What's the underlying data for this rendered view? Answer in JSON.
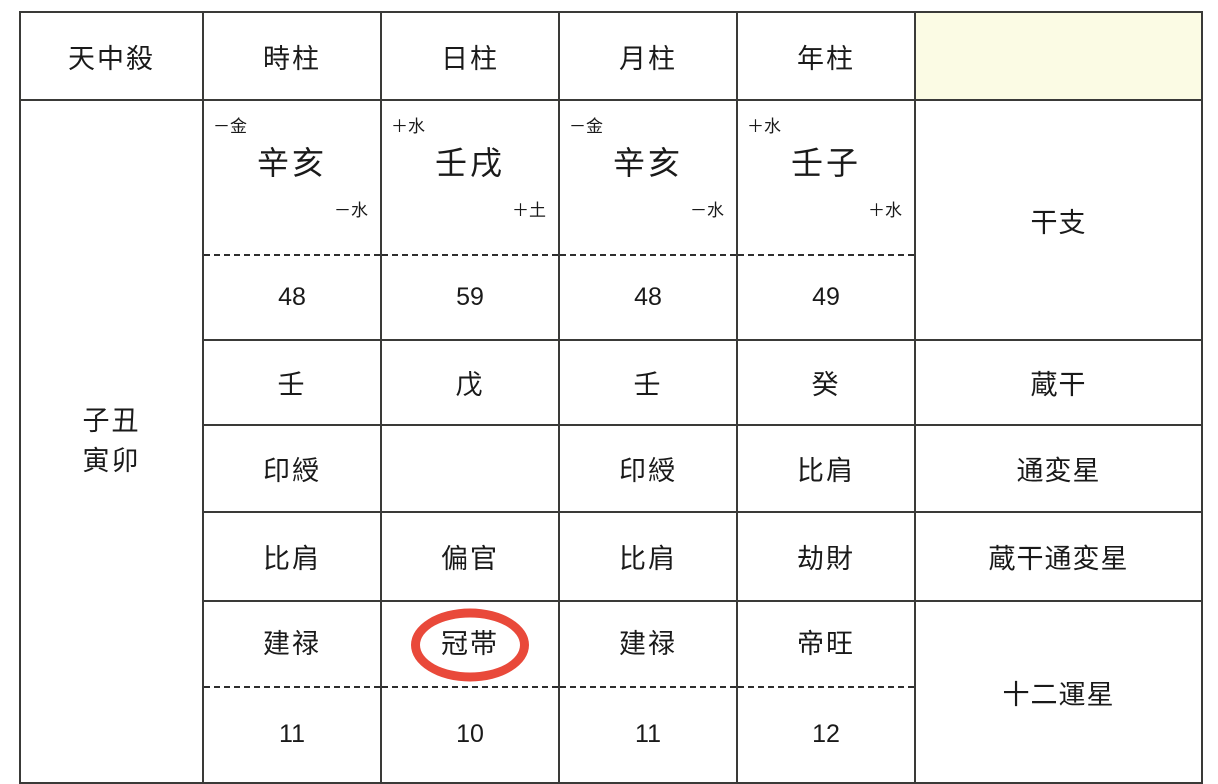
{
  "table": {
    "columns": [
      {
        "key": "tenchusatsu",
        "header": "天中殺"
      },
      {
        "key": "hour",
        "header": "時柱"
      },
      {
        "key": "day",
        "header": "日柱"
      },
      {
        "key": "month",
        "header": "月柱"
      },
      {
        "key": "year",
        "header": "年柱"
      },
      {
        "key": "rowlabel",
        "header": ""
      }
    ],
    "tenchusatsu": {
      "line1": "子丑",
      "line2": "寅卯"
    },
    "row_labels": {
      "ganzhi": "干支",
      "zokan": "蔵干",
      "tsuhensei": "通変星",
      "zokan_tsuhensei": "蔵干通変星",
      "juniunsei": "十二運星"
    },
    "ganzhi": {
      "hour": {
        "top": "－金",
        "main": "辛亥",
        "bottom": "－水",
        "number": "48"
      },
      "day": {
        "top": "＋水",
        "main": "壬戌",
        "bottom": "＋土",
        "number": "59"
      },
      "month": {
        "top": "－金",
        "main": "辛亥",
        "bottom": "－水",
        "number": "48"
      },
      "year": {
        "top": "＋水",
        "main": "壬子",
        "bottom": "＋水",
        "number": "49"
      }
    },
    "zokan": {
      "hour": "壬",
      "day": "戊",
      "month": "壬",
      "year": "癸"
    },
    "tsuhensei": {
      "hour": "印綬",
      "day": "",
      "month": "印綬",
      "year": "比肩"
    },
    "zokan_tsuhensei": {
      "hour": "比肩",
      "day": "偏官",
      "month": "比肩",
      "year": "劫財"
    },
    "juniunsei": {
      "hour": {
        "main": "建禄",
        "number": "11"
      },
      "day": {
        "main": "冠帯",
        "number": "10"
      },
      "month": {
        "main": "建禄",
        "number": "11"
      },
      "year": {
        "main": "帝旺",
        "number": "12"
      }
    },
    "highlight": {
      "column": "day",
      "row": "juniunsei"
    }
  },
  "colors": {
    "header_bg": "#fbfbe4",
    "label_bg": "#e4f5fb",
    "border": "#3a3a38",
    "highlight_ring": "#e9493a",
    "text": "#1a1a1a"
  }
}
